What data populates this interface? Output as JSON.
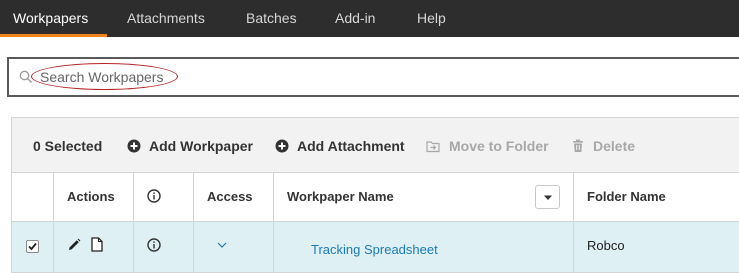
{
  "nav": {
    "tabs": [
      "Workpapers",
      "Attachments",
      "Batches",
      "Add-in",
      "Help"
    ],
    "active_index": 0,
    "accent_color": "#f0831e"
  },
  "search": {
    "placeholder": "Search Workpapers",
    "icon": "search-icon"
  },
  "toolbar": {
    "selected_label": "0 Selected",
    "add_workpaper_label": "Add Workpaper",
    "add_attachment_label": "Add Attachment",
    "move_to_folder_label": "Move to Folder",
    "delete_label": "Delete"
  },
  "table": {
    "columns": [
      "",
      "Actions",
      "",
      "Access",
      "Workpaper Name",
      "Folder Name"
    ],
    "rows": [
      {
        "checked": true,
        "workpaper_name": "Tracking Spreadsheet",
        "folder_name": "Robco"
      }
    ]
  },
  "colors": {
    "nav_bg": "#2d2d2d",
    "row_highlight": "#dff0f4",
    "link": "#1a7bb3",
    "annotation_oval": "#b32424"
  }
}
